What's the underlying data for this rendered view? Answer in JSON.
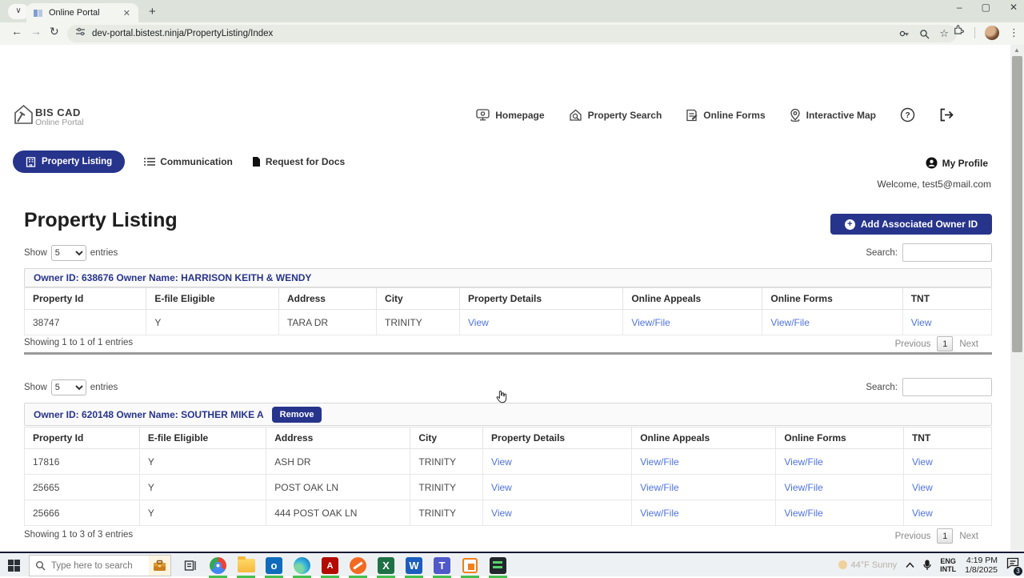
{
  "browser": {
    "tab_title": "Online Portal",
    "url": "dev-portal.bistest.ninja/PropertyListing/Index",
    "new_tab": "+",
    "minimize": "–",
    "maximize": "▢",
    "close": "✕",
    "tab_close": "✕",
    "back": "←",
    "forward": "→",
    "reload": "↻",
    "menu_dots": "⋮",
    "star": "☆",
    "tab_chevron": "∨"
  },
  "header": {
    "brand": "BIS CAD",
    "brand_sub": "Online Portal",
    "nav": [
      {
        "label": "Homepage"
      },
      {
        "label": "Property Search"
      },
      {
        "label": "Online Forms"
      },
      {
        "label": "Interactive Map"
      }
    ]
  },
  "menubar": {
    "property_listing": "Property Listing",
    "communication": "Communication",
    "request_docs": "Request for Docs",
    "my_profile": "My Profile",
    "welcome": "Welcome, test5@mail.com"
  },
  "page": {
    "title": "Property Listing",
    "add_owner_button": "Add Associated Owner ID",
    "plus_glyph": "+"
  },
  "tables": [
    {
      "show_label": "Show",
      "page_size": "5",
      "entries_label": "entries",
      "search_label": "Search:",
      "search_value": "",
      "owner_header": "Owner ID: 638676 Owner Name: HARRISON KEITH & WENDY",
      "columns": [
        "Property Id",
        "E-file Eligible",
        "Address",
        "City",
        "Property Details",
        "Online Appeals",
        "Online Forms",
        "TNT"
      ],
      "rows": [
        [
          "38747",
          "Y",
          "TARA DR",
          "TRINITY",
          "View",
          "View/File",
          "View/File",
          "View"
        ]
      ],
      "showing": "Showing 1 to 1 of 1 entries",
      "prev": "Previous",
      "page_num": "1",
      "next": "Next"
    },
    {
      "show_label": "Show",
      "page_size": "5",
      "entries_label": "entries",
      "search_label": "Search:",
      "search_value": "",
      "owner_header": "Owner ID: 620148 Owner Name: SOUTHER MIKE A",
      "remove_button": "Remove",
      "columns": [
        "Property Id",
        "E-file Eligible",
        "Address",
        "City",
        "Property Details",
        "Online Appeals",
        "Online Forms",
        "TNT"
      ],
      "rows": [
        [
          "17816",
          "Y",
          "ASH DR",
          "TRINITY",
          "View",
          "View/File",
          "View/File",
          "View"
        ],
        [
          "25665",
          "Y",
          "POST OAK LN",
          "TRINITY",
          "View",
          "View/File",
          "View/File",
          "View"
        ],
        [
          "25666",
          "Y",
          "444 POST OAK LN",
          "TRINITY",
          "View",
          "View/File",
          "View/File",
          "View"
        ]
      ],
      "showing": "Showing 1 to 3 of 3 entries",
      "prev": "Previous",
      "page_num": "1",
      "next": "Next"
    }
  ],
  "taskbar": {
    "search_placeholder": "Type here to search",
    "weather": "44°F  Sunny",
    "lang_top": "ENG",
    "lang_bottom": "INTL",
    "time": "4:19 PM",
    "date": "1/8/2025",
    "notification_count": "3"
  },
  "colors": {
    "navy": "#27348c",
    "link": "#4e73df",
    "run_indicator": "#43c04d"
  }
}
